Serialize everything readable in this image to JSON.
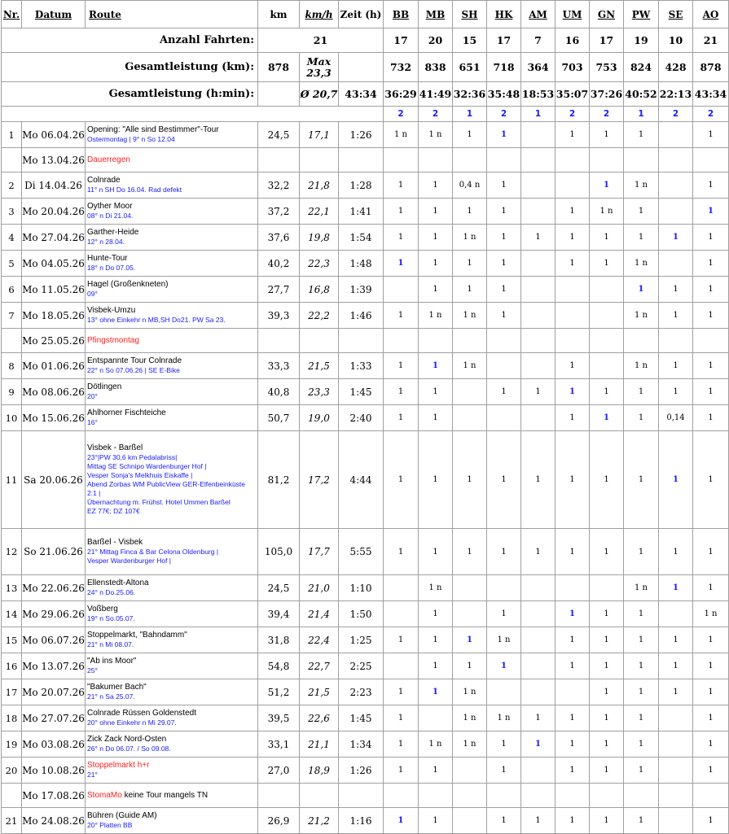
{
  "headers": {
    "nr": "Nr.",
    "datum": "Datum",
    "route": "Route",
    "km": "km",
    "kmh": "km/h",
    "zeit": "Zeit (h)",
    "persons": [
      "BB",
      "MB",
      "SH",
      "HK",
      "AM",
      "UM",
      "GN",
      "PW",
      "SE",
      "AO"
    ]
  },
  "summary": {
    "fahrten_label": "Anzahl Fahrten:",
    "fahrten_total": "21",
    "fahrten": [
      "17",
      "20",
      "15",
      "17",
      "7",
      "16",
      "17",
      "19",
      "10",
      "21"
    ],
    "km_label": "Gesamtleistung (km):",
    "km_total": "878",
    "max_label": "Max",
    "max_value": "23,3",
    "km": [
      "732",
      "838",
      "651",
      "718",
      "364",
      "703",
      "753",
      "824",
      "428",
      "878"
    ],
    "h_label": "Gesamtleistung (h:min):",
    "avg": "Ø 20,7",
    "h_total": "43:34",
    "h": [
      "36:29",
      "41:49",
      "32:36",
      "35:48",
      "18:53",
      "35:07",
      "37:26",
      "40:52",
      "22:13",
      "43:34"
    ],
    "counts": [
      "2",
      "2",
      "1",
      "2",
      "1",
      "2",
      "2",
      "1",
      "2",
      "2"
    ]
  },
  "rows": [
    {
      "nr": "1",
      "date": "Mo 06.04.26",
      "title": "Opening: \"Alle sind Bestimmer\"-Tour",
      "sub": "Ostermontag | 9° n So 12.04",
      "km": "24,5",
      "kmh": "17,1",
      "zeit": "1:26",
      "p": [
        "1 n",
        "1 n",
        "1",
        "1b",
        "",
        "1",
        "1",
        "1",
        "",
        "1"
      ]
    },
    {
      "date": "Mo 13.04.26",
      "title": "",
      "sub": "",
      "red": "Dauerregen",
      "spacer": true
    },
    {
      "nr": "2",
      "date": "Di 14.04.26",
      "title": "Colnrade",
      "sub": "11° n SH Do 16.04. Rad defekt",
      "km": "32,2",
      "kmh": "21,8",
      "zeit": "1:28",
      "p": [
        "1",
        "1",
        "0,4 n",
        "1",
        "",
        "",
        "1b",
        "1 n",
        "",
        "1"
      ]
    },
    {
      "nr": "3",
      "date": "Mo 20.04.26",
      "title": "Oyther Moor",
      "sub": "08° n Di 21.04.",
      "km": "37,2",
      "kmh": "22,1",
      "zeit": "1:41",
      "p": [
        "1",
        "1",
        "1",
        "1",
        "",
        "1",
        "1 n",
        "1",
        "",
        "1b"
      ]
    },
    {
      "nr": "4",
      "date": "Mo 27.04.26",
      "title": "Garther-Heide",
      "sub": "12° n 28.04.",
      "km": "37,6",
      "kmh": "19,8",
      "zeit": "1:54",
      "p": [
        "1",
        "1",
        "1 n",
        "1",
        "1",
        "1",
        "1",
        "1",
        "1b",
        "1"
      ]
    },
    {
      "nr": "5",
      "date": "Mo 04.05.26",
      "title": "Hunte-Tour",
      "sub": "18° n Do 07.05.",
      "km": "40,2",
      "kmh": "22,3",
      "zeit": "1:48",
      "p": [
        "1b",
        "1",
        "1",
        "1",
        "",
        "1",
        "1",
        "1 n",
        "",
        "1"
      ]
    },
    {
      "nr": "6",
      "date": "Mo 11.05.26",
      "title": "Hagel (Großenkneten)",
      "sub": "09°",
      "km": "27,7",
      "kmh": "16,8",
      "zeit": "1:39",
      "p": [
        "",
        "1",
        "1",
        "1",
        "",
        "",
        "",
        "1b",
        "1",
        "1"
      ]
    },
    {
      "nr": "7",
      "date": "Mo 18.05.26",
      "title": "Visbek-Umzu",
      "sub": "13° ohne Einkehr n MB,SH Do21. PW Sa 23.",
      "km": "39,3",
      "kmh": "22,2",
      "zeit": "1:46",
      "p": [
        "1",
        "1 n",
        "1 n",
        "1",
        "",
        "",
        "",
        "1 n",
        "1",
        "1"
      ]
    },
    {
      "date": "Mo 25.05.26",
      "title": "",
      "sub": "",
      "red": "Pfingstmontag",
      "spacer": true
    },
    {
      "nr": "8",
      "date": "Mo 01.06.26",
      "title": "Entspannte Tour Colnrade",
      "sub": "22°  n So 07.06.26 | SE E-Bike",
      "km": "33,3",
      "kmh": "21,5",
      "zeit": "1:33",
      "p": [
        "1",
        "1b",
        "1 n",
        "",
        "",
        "1",
        "",
        "1 n",
        "1",
        "1"
      ]
    },
    {
      "nr": "9",
      "date": "Mo 08.06.26",
      "title": "Dötlingen",
      "sub": "20°",
      "km": "40,8",
      "kmh": "23,3",
      "zeit": "1:45",
      "p": [
        "1",
        "1",
        "",
        "1",
        "1",
        "1b",
        "1",
        "1",
        "1",
        "1"
      ]
    },
    {
      "nr": "10",
      "date": "Mo 15.06.26",
      "title": "Ahlhorner Fischteiche",
      "sub": "16°",
      "km": "50,7",
      "kmh": "19,0",
      "zeit": "2:40",
      "p": [
        "1",
        "1",
        "",
        "",
        "",
        "1",
        "1b",
        "1",
        "0,14",
        "1"
      ]
    },
    {
      "nr": "11",
      "date": "Sa 20.06.26",
      "title": "Visbek - Barßel",
      "sub": "23°|PW 30,6 km Pedalabriss|\nMittag SE Schnipo Wardenburger Hof |\nVesper Sonja's Melkhuis Eiskaffe |\nAbend Zorbas WM PublicView GER-Elfenbeinküste 2:1 |\nÜbernachtung m. Frühst. Hotel Ummen Barßel\nEZ 77€; DZ 107€",
      "km": "81,2",
      "kmh": "17,2",
      "zeit": "4:44",
      "p": [
        "1",
        "1",
        "1",
        "1",
        "1",
        "1",
        "1",
        "1",
        "1b",
        "1"
      ],
      "tall": true
    },
    {
      "nr": "12",
      "date": "So 21.06.26",
      "title": "Barßel - Visbek",
      "sub": "21° Mittag Finca & Bar Celona Oldenburg |\nVesper Wardenburger Hof |",
      "km": "105,0",
      "kmh": "17,7",
      "zeit": "5:55",
      "p": [
        "1",
        "1",
        "1",
        "1",
        "1",
        "1",
        "1",
        "1",
        "1",
        "1"
      ]
    },
    {
      "nr": "13",
      "date": "Mo 22.06.26",
      "title": "Ellenstedt-Altona",
      "sub": "24° n Do.25.06.",
      "km": "24,5",
      "kmh": "21,0",
      "zeit": "1:10",
      "p": [
        "",
        "1 n",
        "",
        "",
        "",
        "",
        "",
        "1 n",
        "1b",
        "1"
      ]
    },
    {
      "nr": "14",
      "date": "Mo 29.06.26",
      "title": "Voßberg",
      "sub": "19° n So.05.07.",
      "km": "39,4",
      "kmh": "21,4",
      "zeit": "1:50",
      "p": [
        "",
        "1",
        "",
        "1",
        "",
        "1b",
        "1",
        "1",
        "",
        "1 n"
      ]
    },
    {
      "nr": "15",
      "date": "Mo 06.07.26",
      "title": "Stoppelmarkt, \"Bahndamm\"",
      "sub": "21° n Mi 08.07.",
      "km": "31,8",
      "kmh": "22,4",
      "zeit": "1:25",
      "p": [
        "1",
        "1",
        "1b",
        "1 n",
        "",
        "1",
        "1",
        "1",
        "1",
        "1"
      ]
    },
    {
      "nr": "16",
      "date": "Mo 13.07.26",
      "title": "\"Ab ins Moor\"",
      "sub": "25°",
      "km": "54,8",
      "kmh": "22,7",
      "zeit": "2:25",
      "p": [
        "",
        "1",
        "1",
        "1b",
        "",
        "1",
        "1",
        "1",
        "1",
        "1"
      ]
    },
    {
      "nr": "17",
      "date": "Mo 20.07.26",
      "title": "\"Bakumer Bach\"",
      "sub": "21° n Sa 25.07.",
      "km": "51,2",
      "kmh": "21,5",
      "zeit": "2:23",
      "p": [
        "1",
        "1b",
        "1 n",
        "",
        "",
        "",
        "1",
        "1",
        "1",
        "1"
      ]
    },
    {
      "nr": "18",
      "date": "Mo 27.07.26",
      "title": "Colnrade Rüssen Goldenstedt",
      "sub": "20° ohne Einkehr n Mi 29.07.",
      "km": "39,5",
      "kmh": "22,6",
      "zeit": "1:45",
      "p": [
        "1",
        "",
        "1 n",
        "1 n",
        "1",
        "1",
        "1",
        "1",
        "",
        "1"
      ]
    },
    {
      "nr": "19",
      "date": "Mo 03.08.26",
      "title": "Zick Zack Nord-Osten",
      "sub": "26° n Do 06.07. / So 09.08.",
      "km": "33,1",
      "kmh": "21,1",
      "zeit": "1:34",
      "p": [
        "1",
        "1 n",
        "1 n",
        "1",
        "1b",
        "1",
        "1",
        "1",
        "",
        "1"
      ]
    },
    {
      "nr": "20",
      "date": "Mo 10.08.26",
      "title": "",
      "red": "Stoppelmarkt h+r",
      "sub": "21°",
      "km": "27,0",
      "kmh": "18,9",
      "zeit": "1:26",
      "p": [
        "1",
        "1",
        "",
        "1",
        "",
        "1",
        "1",
        "1",
        "",
        "1"
      ]
    },
    {
      "date": "Mo 17.08.26",
      "title": "",
      "red": "StomaMo",
      "after": " keine Tour mangels TN",
      "sub": "",
      "spacer": true
    },
    {
      "nr": "21",
      "date": "Mo 24.08.26",
      "title": "Bühren (Guide AM)",
      "sub": "20° Platten BB",
      "km": "26,9",
      "kmh": "21,2",
      "zeit": "1:16",
      "p": [
        "1b",
        "1",
        "",
        "1",
        "1",
        "1",
        "1",
        "1",
        "",
        "1"
      ]
    }
  ]
}
